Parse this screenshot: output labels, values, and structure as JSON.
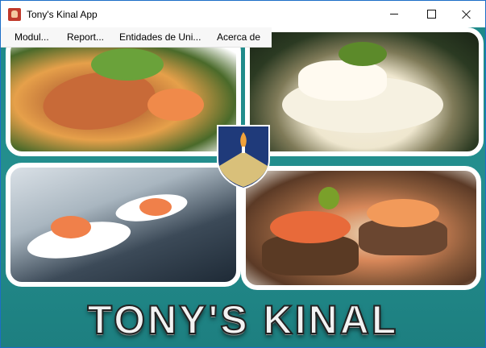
{
  "window": {
    "title": "Tony's Kinal App",
    "icon": "app-icon",
    "controls": {
      "minimize": "minimize-icon",
      "maximize": "maximize-icon",
      "close": "close-icon"
    }
  },
  "menu": {
    "items": [
      {
        "label": "Modul..."
      },
      {
        "label": "Report..."
      },
      {
        "label": "Entidades de Uni..."
      },
      {
        "label": "Acerca de"
      }
    ]
  },
  "content": {
    "brand_text": "TONY'S KINAL",
    "emblem": "shield-emblem-icon",
    "photos": [
      "salmon-dish-photo",
      "fish-puree-photo",
      "salmon-spoons-photo",
      "canape-photo"
    ]
  },
  "colors": {
    "background": "#248f8e",
    "shield_blue": "#1f3a7a",
    "shield_gold": "#d9c07a",
    "titlebar_border": "#1c6ec7"
  }
}
